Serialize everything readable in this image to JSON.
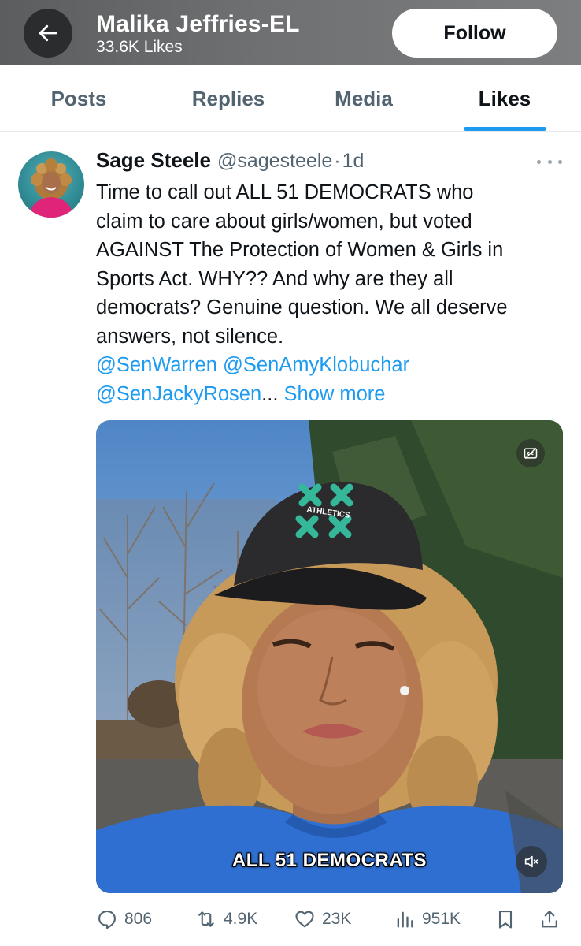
{
  "header": {
    "name": "Malika Jeffries-EL",
    "likes_count": "33.6K Likes",
    "follow_label": "Follow"
  },
  "tabs": [
    {
      "label": "Posts",
      "active": false
    },
    {
      "label": "Replies",
      "active": false
    },
    {
      "label": "Media",
      "active": false
    },
    {
      "label": "Likes",
      "active": true
    }
  ],
  "tweet": {
    "author_name": "Sage Steele",
    "author_handle": "@sagesteele",
    "separator": "·",
    "time": "1d",
    "text_lines": [
      "Time to call out ALL 51 DEMOCRATS who",
      "claim to care about girls/women, but voted",
      "AGAINST The Protection of Women & Girls in",
      "Sports Act. WHY?? And why are they all",
      "democrats? Genuine question.  We all deserve",
      "answers, not silence."
    ],
    "mentions_line1": "@SenWarren @SenAmyKlobuchar",
    "mentions_line2": "@SenJackyRosen",
    "ellipsis": "...",
    "show_more": "Show more",
    "video": {
      "caption": "ALL 51 DEMOCRATS",
      "cap_logo": "ATHLETICS"
    },
    "stats": {
      "replies": "806",
      "reposts": "4.9K",
      "likes": "23K",
      "views": "951K"
    }
  },
  "colors": {
    "accent": "#1d9bf0",
    "text": "#0f1419",
    "muted": "#536471"
  }
}
